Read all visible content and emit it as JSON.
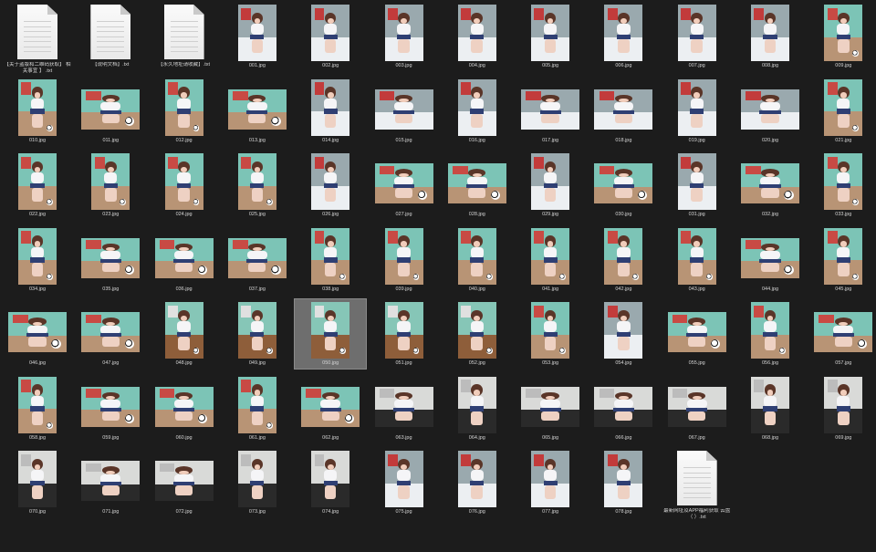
{
  "view": "file-explorer-large-icons",
  "colors": {
    "background": "#1c1c1c",
    "selection": "#6e6e6e",
    "label": "#d4d4d4"
  },
  "icon_names": {
    "document": "text-document-icon",
    "image": "image-thumbnail-icon"
  },
  "files": [
    {
      "name": "【关于盗版和二维码获取】 相关事宜 】 .txt",
      "kind": "doc"
    },
    {
      "name": "【说明文档】.txt",
      "kind": "doc"
    },
    {
      "name": "【永久地址请收藏】.txt",
      "kind": "doc"
    },
    {
      "name": "001.jpg",
      "kind": "img",
      "orient": "portrait",
      "scene": "bed"
    },
    {
      "name": "002.jpg",
      "kind": "img",
      "orient": "portrait",
      "scene": "bed"
    },
    {
      "name": "003.jpg",
      "kind": "img",
      "orient": "portrait",
      "scene": "bed"
    },
    {
      "name": "004.jpg",
      "kind": "img",
      "orient": "portrait",
      "scene": "bed"
    },
    {
      "name": "005.jpg",
      "kind": "img",
      "orient": "portrait",
      "scene": "bed"
    },
    {
      "name": "006.jpg",
      "kind": "img",
      "orient": "portrait",
      "scene": "bed"
    },
    {
      "name": "007.jpg",
      "kind": "img",
      "orient": "portrait",
      "scene": "bed"
    },
    {
      "name": "008.jpg",
      "kind": "img",
      "orient": "portrait",
      "scene": "bed"
    },
    {
      "name": "009.jpg",
      "kind": "img",
      "orient": "portrait",
      "scene": "teal"
    },
    {
      "name": "010.jpg",
      "kind": "img",
      "orient": "portrait",
      "scene": "teal"
    },
    {
      "name": "011.jpg",
      "kind": "img",
      "orient": "landscape",
      "scene": "teal"
    },
    {
      "name": "012.jpg",
      "kind": "img",
      "orient": "portrait",
      "scene": "teal"
    },
    {
      "name": "013.jpg",
      "kind": "img",
      "orient": "landscape",
      "scene": "teal"
    },
    {
      "name": "014.jpg",
      "kind": "img",
      "orient": "portrait",
      "scene": "bed"
    },
    {
      "name": "015.jpg",
      "kind": "img",
      "orient": "landscape",
      "scene": "bed"
    },
    {
      "name": "016.jpg",
      "kind": "img",
      "orient": "portrait",
      "scene": "bed"
    },
    {
      "name": "017.jpg",
      "kind": "img",
      "orient": "landscape",
      "scene": "bed"
    },
    {
      "name": "018.jpg",
      "kind": "img",
      "orient": "landscape",
      "scene": "bed"
    },
    {
      "name": "019.jpg",
      "kind": "img",
      "orient": "portrait",
      "scene": "bed"
    },
    {
      "name": "020.jpg",
      "kind": "img",
      "orient": "landscape",
      "scene": "bed"
    },
    {
      "name": "021.jpg",
      "kind": "img",
      "orient": "portrait",
      "scene": "teal"
    },
    {
      "name": "022.jpg",
      "kind": "img",
      "orient": "portrait",
      "scene": "teal"
    },
    {
      "name": "023.jpg",
      "kind": "img",
      "orient": "portrait",
      "scene": "teal"
    },
    {
      "name": "024.jpg",
      "kind": "img",
      "orient": "portrait",
      "scene": "teal"
    },
    {
      "name": "025.jpg",
      "kind": "img",
      "orient": "portrait",
      "scene": "teal"
    },
    {
      "name": "026.jpg",
      "kind": "img",
      "orient": "portrait",
      "scene": "bed"
    },
    {
      "name": "027.jpg",
      "kind": "img",
      "orient": "landscape",
      "scene": "teal"
    },
    {
      "name": "028.jpg",
      "kind": "img",
      "orient": "landscape",
      "scene": "teal"
    },
    {
      "name": "029.jpg",
      "kind": "img",
      "orient": "portrait",
      "scene": "bed"
    },
    {
      "name": "030.jpg",
      "kind": "img",
      "orient": "landscape",
      "scene": "teal"
    },
    {
      "name": "031.jpg",
      "kind": "img",
      "orient": "portrait",
      "scene": "bed"
    },
    {
      "name": "032.jpg",
      "kind": "img",
      "orient": "landscape",
      "scene": "teal"
    },
    {
      "name": "033.jpg",
      "kind": "img",
      "orient": "portrait",
      "scene": "teal"
    },
    {
      "name": "034.jpg",
      "kind": "img",
      "orient": "portrait",
      "scene": "teal"
    },
    {
      "name": "035.jpg",
      "kind": "img",
      "orient": "landscape",
      "scene": "teal"
    },
    {
      "name": "036.jpg",
      "kind": "img",
      "orient": "landscape",
      "scene": "teal"
    },
    {
      "name": "037.jpg",
      "kind": "img",
      "orient": "landscape",
      "scene": "teal"
    },
    {
      "name": "038.jpg",
      "kind": "img",
      "orient": "portrait",
      "scene": "teal"
    },
    {
      "name": "039.jpg",
      "kind": "img",
      "orient": "portrait",
      "scene": "teal"
    },
    {
      "name": "040.jpg",
      "kind": "img",
      "orient": "portrait",
      "scene": "teal"
    },
    {
      "name": "041.jpg",
      "kind": "img",
      "orient": "portrait",
      "scene": "teal"
    },
    {
      "name": "042.jpg",
      "kind": "img",
      "orient": "portrait",
      "scene": "teal"
    },
    {
      "name": "043.jpg",
      "kind": "img",
      "orient": "portrait",
      "scene": "teal"
    },
    {
      "name": "044.jpg",
      "kind": "img",
      "orient": "landscape",
      "scene": "teal"
    },
    {
      "name": "045.jpg",
      "kind": "img",
      "orient": "portrait",
      "scene": "teal"
    },
    {
      "name": "046.jpg",
      "kind": "img",
      "orient": "landscape",
      "scene": "teal"
    },
    {
      "name": "047.jpg",
      "kind": "img",
      "orient": "landscape",
      "scene": "teal"
    },
    {
      "name": "048.jpg",
      "kind": "img",
      "orient": "portrait",
      "scene": "wood"
    },
    {
      "name": "049.jpg",
      "kind": "img",
      "orient": "portrait",
      "scene": "wood"
    },
    {
      "name": "050.jpg",
      "kind": "img",
      "orient": "portrait",
      "scene": "wood",
      "selected": true
    },
    {
      "name": "051.jpg",
      "kind": "img",
      "orient": "portrait",
      "scene": "wood"
    },
    {
      "name": "052.jpg",
      "kind": "img",
      "orient": "portrait",
      "scene": "wood"
    },
    {
      "name": "053.jpg",
      "kind": "img",
      "orient": "portrait",
      "scene": "teal"
    },
    {
      "name": "054.jpg",
      "kind": "img",
      "orient": "portrait",
      "scene": "bed"
    },
    {
      "name": "055.jpg",
      "kind": "img",
      "orient": "landscape",
      "scene": "teal"
    },
    {
      "name": "056.jpg",
      "kind": "img",
      "orient": "portrait",
      "scene": "teal"
    },
    {
      "name": "057.jpg",
      "kind": "img",
      "orient": "landscape",
      "scene": "teal"
    },
    {
      "name": "058.jpg",
      "kind": "img",
      "orient": "portrait",
      "scene": "teal"
    },
    {
      "name": "059.jpg",
      "kind": "img",
      "orient": "landscape",
      "scene": "teal"
    },
    {
      "name": "060.jpg",
      "kind": "img",
      "orient": "landscape",
      "scene": "teal"
    },
    {
      "name": "061.jpg",
      "kind": "img",
      "orient": "portrait",
      "scene": "teal"
    },
    {
      "name": "062.jpg",
      "kind": "img",
      "orient": "landscape",
      "scene": "teal"
    },
    {
      "name": "063.jpg",
      "kind": "img",
      "orient": "landscape",
      "scene": "dark"
    },
    {
      "name": "064.jpg",
      "kind": "img",
      "orient": "portrait",
      "scene": "dark"
    },
    {
      "name": "065.jpg",
      "kind": "img",
      "orient": "landscape",
      "scene": "dark"
    },
    {
      "name": "066.jpg",
      "kind": "img",
      "orient": "landscape",
      "scene": "dark"
    },
    {
      "name": "067.jpg",
      "kind": "img",
      "orient": "landscape",
      "scene": "dark"
    },
    {
      "name": "068.jpg",
      "kind": "img",
      "orient": "portrait",
      "scene": "dark"
    },
    {
      "name": "069.jpg",
      "kind": "img",
      "orient": "portrait",
      "scene": "dark"
    },
    {
      "name": "070.jpg",
      "kind": "img",
      "orient": "portrait",
      "scene": "dark"
    },
    {
      "name": "071.jpg",
      "kind": "img",
      "orient": "landscape",
      "scene": "dark"
    },
    {
      "name": "072.jpg",
      "kind": "img",
      "orient": "landscape",
      "scene": "dark"
    },
    {
      "name": "073.jpg",
      "kind": "img",
      "orient": "portrait",
      "scene": "dark"
    },
    {
      "name": "074.jpg",
      "kind": "img",
      "orient": "portrait",
      "scene": "dark"
    },
    {
      "name": "075.jpg",
      "kind": "img",
      "orient": "portrait",
      "scene": "bed"
    },
    {
      "name": "076.jpg",
      "kind": "img",
      "orient": "portrait",
      "scene": "bed"
    },
    {
      "name": "077.jpg",
      "kind": "img",
      "orient": "portrait",
      "scene": "bed"
    },
    {
      "name": "078.jpg",
      "kind": "img",
      "orient": "portrait",
      "scene": "bed"
    },
    {
      "name": "最新网址及APP福利获取 云盘（ ）.txt",
      "kind": "doc"
    }
  ]
}
